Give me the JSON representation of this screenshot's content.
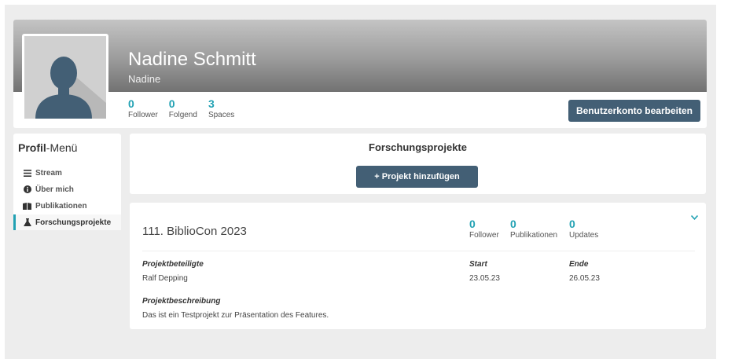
{
  "profile": {
    "name": "Nadine Schmitt",
    "username": "Nadine",
    "stats": [
      {
        "value": "0",
        "label": "Follower"
      },
      {
        "value": "0",
        "label": "Folgend"
      },
      {
        "value": "3",
        "label": "Spaces"
      }
    ],
    "edit_button": "Benutzerkonto bearbeiten"
  },
  "menu": {
    "title_bold": "Profil",
    "title_rest": "-Menü",
    "items": [
      {
        "label": "Stream",
        "icon": "bars-icon"
      },
      {
        "label": "Über mich",
        "icon": "info-icon"
      },
      {
        "label": "Publikationen",
        "icon": "book-icon"
      },
      {
        "label": "Forschungsprojekte",
        "icon": "flask-icon"
      }
    ]
  },
  "projects_header": {
    "title": "Forschungsprojekte",
    "add_button": "+ Projekt hinzufügen"
  },
  "project": {
    "title": "111. BiblioCon 2023",
    "stats": [
      {
        "value": "0",
        "label": "Follower"
      },
      {
        "value": "0",
        "label": "Publikationen"
      },
      {
        "value": "0",
        "label": "Updates"
      }
    ],
    "participants_label": "Projektbeteiligte",
    "participants_value": "Ralf Depping",
    "start_label": "Start",
    "start_value": "23.05.23",
    "end_label": "Ende",
    "end_value": "26.05.23",
    "description_label": "Projektbeschreibung",
    "description_value": "Das ist ein Testprojekt zur Präsentation des Features."
  },
  "colors": {
    "accent": "#21a1b3",
    "button": "#435f75",
    "background": "#ededed"
  }
}
